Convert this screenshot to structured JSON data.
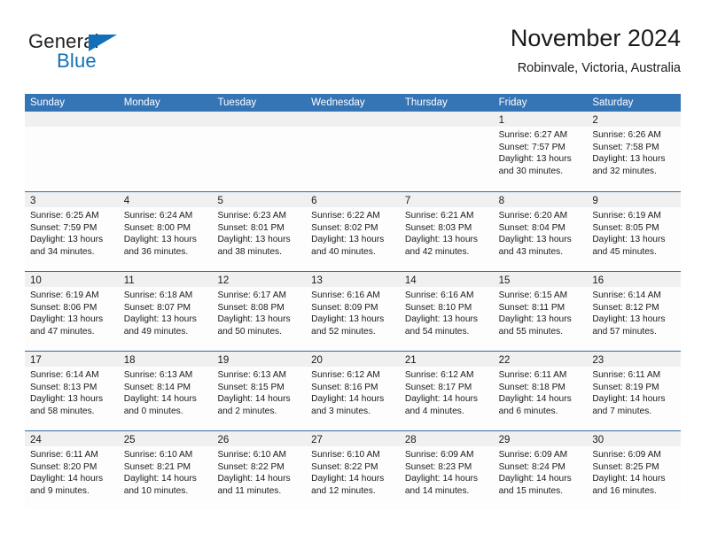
{
  "brand": {
    "word_general": "General",
    "word_blue": "Blue",
    "triangle_color": "#1270b8"
  },
  "header": {
    "title": "November 2024",
    "location": "Robinvale, Victoria, Australia"
  },
  "colors": {
    "header_bar": "#3575b5",
    "row_divider": "#2e6da4",
    "daynum_band": "#f0f0f0",
    "brand_blue": "#1270b8"
  },
  "weekday_headers": [
    "Sunday",
    "Monday",
    "Tuesday",
    "Wednesday",
    "Thursday",
    "Friday",
    "Saturday"
  ],
  "labels": {
    "sunrise_prefix": "Sunrise:",
    "sunset_prefix": "Sunset:",
    "daylight_prefix": "Daylight:"
  },
  "weeks": [
    [
      {
        "day": "",
        "empty": true
      },
      {
        "day": "",
        "empty": true
      },
      {
        "day": "",
        "empty": true
      },
      {
        "day": "",
        "empty": true
      },
      {
        "day": "",
        "empty": true
      },
      {
        "day": "1",
        "sunrise": "Sunrise: 6:27 AM",
        "sunset": "Sunset: 7:57 PM",
        "daylight1": "Daylight: 13 hours",
        "daylight2": "and 30 minutes."
      },
      {
        "day": "2",
        "sunrise": "Sunrise: 6:26 AM",
        "sunset": "Sunset: 7:58 PM",
        "daylight1": "Daylight: 13 hours",
        "daylight2": "and 32 minutes."
      }
    ],
    [
      {
        "day": "3",
        "sunrise": "Sunrise: 6:25 AM",
        "sunset": "Sunset: 7:59 PM",
        "daylight1": "Daylight: 13 hours",
        "daylight2": "and 34 minutes."
      },
      {
        "day": "4",
        "sunrise": "Sunrise: 6:24 AM",
        "sunset": "Sunset: 8:00 PM",
        "daylight1": "Daylight: 13 hours",
        "daylight2": "and 36 minutes."
      },
      {
        "day": "5",
        "sunrise": "Sunrise: 6:23 AM",
        "sunset": "Sunset: 8:01 PM",
        "daylight1": "Daylight: 13 hours",
        "daylight2": "and 38 minutes."
      },
      {
        "day": "6",
        "sunrise": "Sunrise: 6:22 AM",
        "sunset": "Sunset: 8:02 PM",
        "daylight1": "Daylight: 13 hours",
        "daylight2": "and 40 minutes."
      },
      {
        "day": "7",
        "sunrise": "Sunrise: 6:21 AM",
        "sunset": "Sunset: 8:03 PM",
        "daylight1": "Daylight: 13 hours",
        "daylight2": "and 42 minutes."
      },
      {
        "day": "8",
        "sunrise": "Sunrise: 6:20 AM",
        "sunset": "Sunset: 8:04 PM",
        "daylight1": "Daylight: 13 hours",
        "daylight2": "and 43 minutes."
      },
      {
        "day": "9",
        "sunrise": "Sunrise: 6:19 AM",
        "sunset": "Sunset: 8:05 PM",
        "daylight1": "Daylight: 13 hours",
        "daylight2": "and 45 minutes."
      }
    ],
    [
      {
        "day": "10",
        "sunrise": "Sunrise: 6:19 AM",
        "sunset": "Sunset: 8:06 PM",
        "daylight1": "Daylight: 13 hours",
        "daylight2": "and 47 minutes."
      },
      {
        "day": "11",
        "sunrise": "Sunrise: 6:18 AM",
        "sunset": "Sunset: 8:07 PM",
        "daylight1": "Daylight: 13 hours",
        "daylight2": "and 49 minutes."
      },
      {
        "day": "12",
        "sunrise": "Sunrise: 6:17 AM",
        "sunset": "Sunset: 8:08 PM",
        "daylight1": "Daylight: 13 hours",
        "daylight2": "and 50 minutes."
      },
      {
        "day": "13",
        "sunrise": "Sunrise: 6:16 AM",
        "sunset": "Sunset: 8:09 PM",
        "daylight1": "Daylight: 13 hours",
        "daylight2": "and 52 minutes."
      },
      {
        "day": "14",
        "sunrise": "Sunrise: 6:16 AM",
        "sunset": "Sunset: 8:10 PM",
        "daylight1": "Daylight: 13 hours",
        "daylight2": "and 54 minutes."
      },
      {
        "day": "15",
        "sunrise": "Sunrise: 6:15 AM",
        "sunset": "Sunset: 8:11 PM",
        "daylight1": "Daylight: 13 hours",
        "daylight2": "and 55 minutes."
      },
      {
        "day": "16",
        "sunrise": "Sunrise: 6:14 AM",
        "sunset": "Sunset: 8:12 PM",
        "daylight1": "Daylight: 13 hours",
        "daylight2": "and 57 minutes."
      }
    ],
    [
      {
        "day": "17",
        "sunrise": "Sunrise: 6:14 AM",
        "sunset": "Sunset: 8:13 PM",
        "daylight1": "Daylight: 13 hours",
        "daylight2": "and 58 minutes."
      },
      {
        "day": "18",
        "sunrise": "Sunrise: 6:13 AM",
        "sunset": "Sunset: 8:14 PM",
        "daylight1": "Daylight: 14 hours",
        "daylight2": "and 0 minutes."
      },
      {
        "day": "19",
        "sunrise": "Sunrise: 6:13 AM",
        "sunset": "Sunset: 8:15 PM",
        "daylight1": "Daylight: 14 hours",
        "daylight2": "and 2 minutes."
      },
      {
        "day": "20",
        "sunrise": "Sunrise: 6:12 AM",
        "sunset": "Sunset: 8:16 PM",
        "daylight1": "Daylight: 14 hours",
        "daylight2": "and 3 minutes."
      },
      {
        "day": "21",
        "sunrise": "Sunrise: 6:12 AM",
        "sunset": "Sunset: 8:17 PM",
        "daylight1": "Daylight: 14 hours",
        "daylight2": "and 4 minutes."
      },
      {
        "day": "22",
        "sunrise": "Sunrise: 6:11 AM",
        "sunset": "Sunset: 8:18 PM",
        "daylight1": "Daylight: 14 hours",
        "daylight2": "and 6 minutes."
      },
      {
        "day": "23",
        "sunrise": "Sunrise: 6:11 AM",
        "sunset": "Sunset: 8:19 PM",
        "daylight1": "Daylight: 14 hours",
        "daylight2": "and 7 minutes."
      }
    ],
    [
      {
        "day": "24",
        "sunrise": "Sunrise: 6:11 AM",
        "sunset": "Sunset: 8:20 PM",
        "daylight1": "Daylight: 14 hours",
        "daylight2": "and 9 minutes."
      },
      {
        "day": "25",
        "sunrise": "Sunrise: 6:10 AM",
        "sunset": "Sunset: 8:21 PM",
        "daylight1": "Daylight: 14 hours",
        "daylight2": "and 10 minutes."
      },
      {
        "day": "26",
        "sunrise": "Sunrise: 6:10 AM",
        "sunset": "Sunset: 8:22 PM",
        "daylight1": "Daylight: 14 hours",
        "daylight2": "and 11 minutes."
      },
      {
        "day": "27",
        "sunrise": "Sunrise: 6:10 AM",
        "sunset": "Sunset: 8:22 PM",
        "daylight1": "Daylight: 14 hours",
        "daylight2": "and 12 minutes."
      },
      {
        "day": "28",
        "sunrise": "Sunrise: 6:09 AM",
        "sunset": "Sunset: 8:23 PM",
        "daylight1": "Daylight: 14 hours",
        "daylight2": "and 14 minutes."
      },
      {
        "day": "29",
        "sunrise": "Sunrise: 6:09 AM",
        "sunset": "Sunset: 8:24 PM",
        "daylight1": "Daylight: 14 hours",
        "daylight2": "and 15 minutes."
      },
      {
        "day": "30",
        "sunrise": "Sunrise: 6:09 AM",
        "sunset": "Sunset: 8:25 PM",
        "daylight1": "Daylight: 14 hours",
        "daylight2": "and 16 minutes."
      }
    ]
  ]
}
